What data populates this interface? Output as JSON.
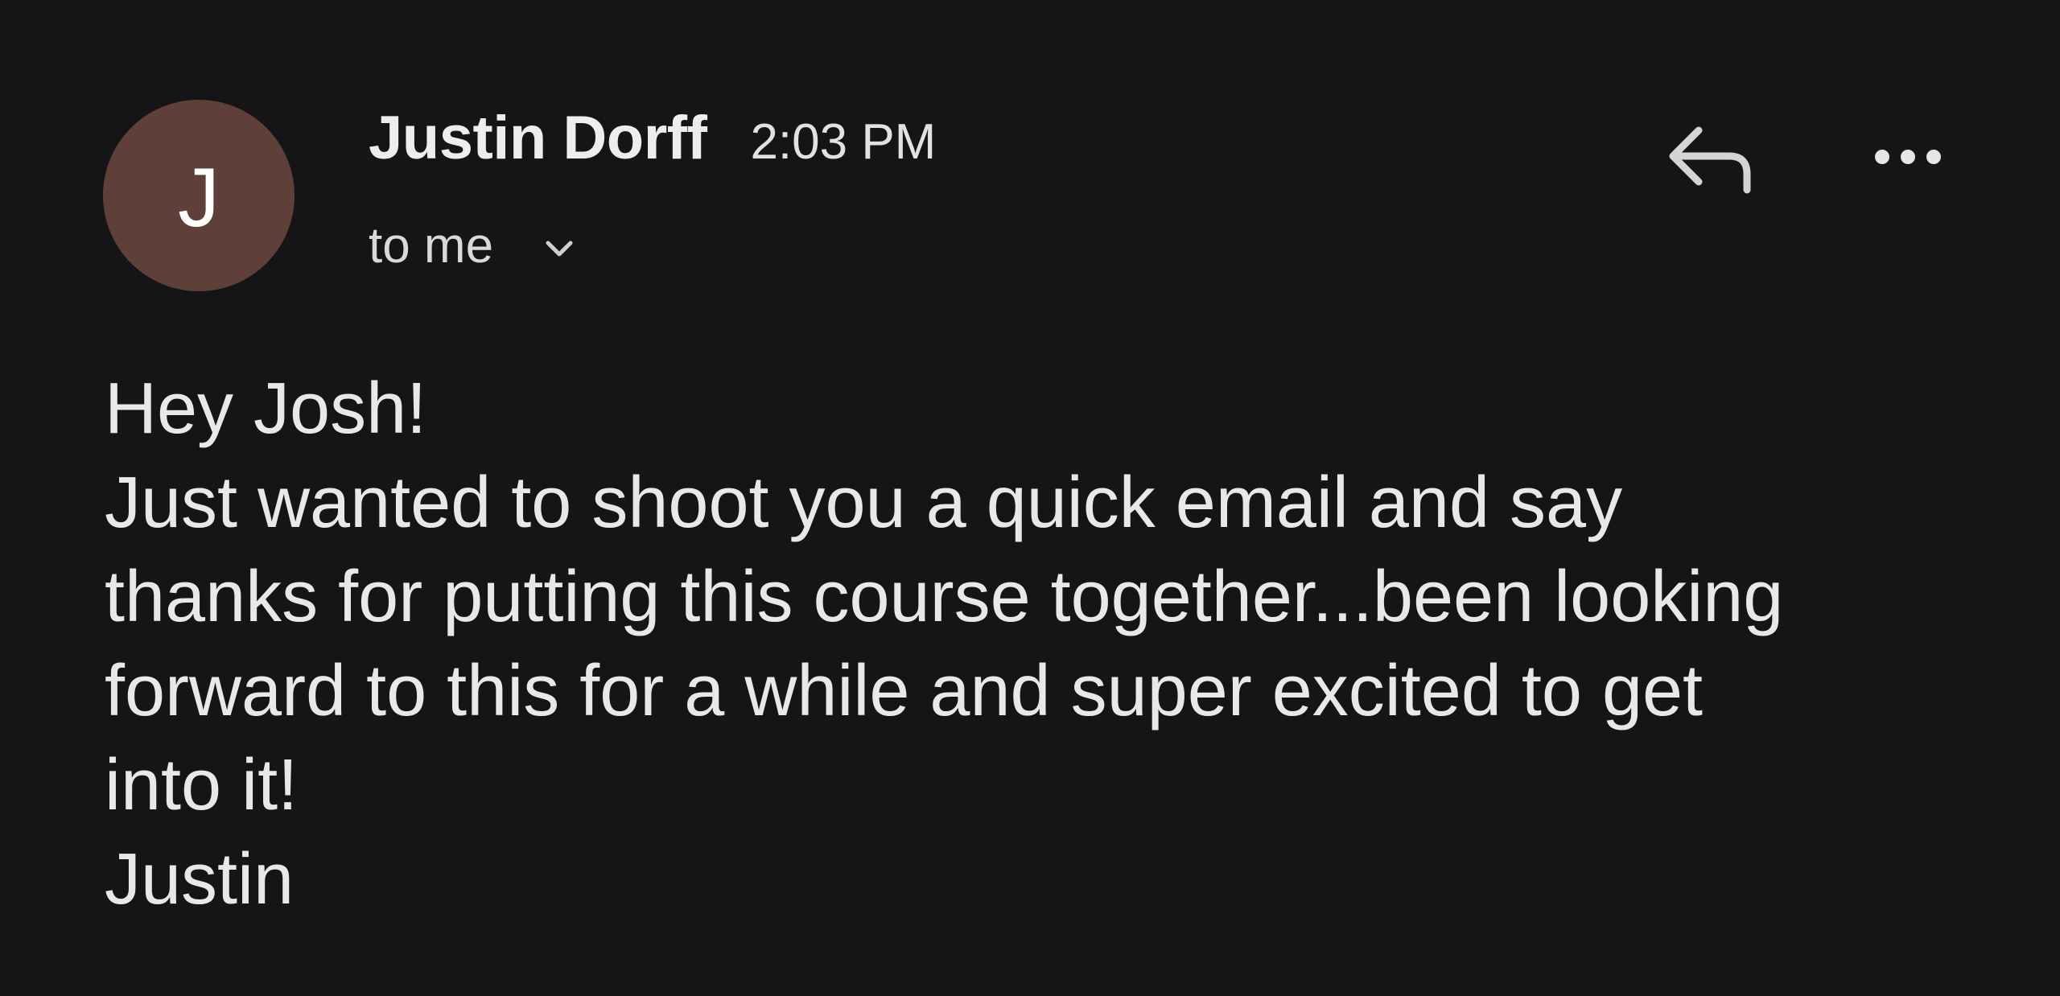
{
  "sender": {
    "avatar_letter": "J",
    "avatar_color": "#5e4038",
    "name": "Justin Dorff",
    "time": "2:03 PM"
  },
  "recipients": {
    "label": "to me",
    "expand_icon": "chevron-down-icon"
  },
  "actions": {
    "reply_icon": "reply-icon",
    "more_icon": "more-horizontal-icon"
  },
  "message": {
    "lines": [
      "Hey Josh!",
      "Just wanted to shoot you a quick email and say",
      "thanks for putting this course together...been looking",
      "forward to this for a while and super excited to get",
      "into it!",
      "Justin"
    ]
  },
  "colors": {
    "background": "#151517",
    "text": "#e8e8e8"
  }
}
